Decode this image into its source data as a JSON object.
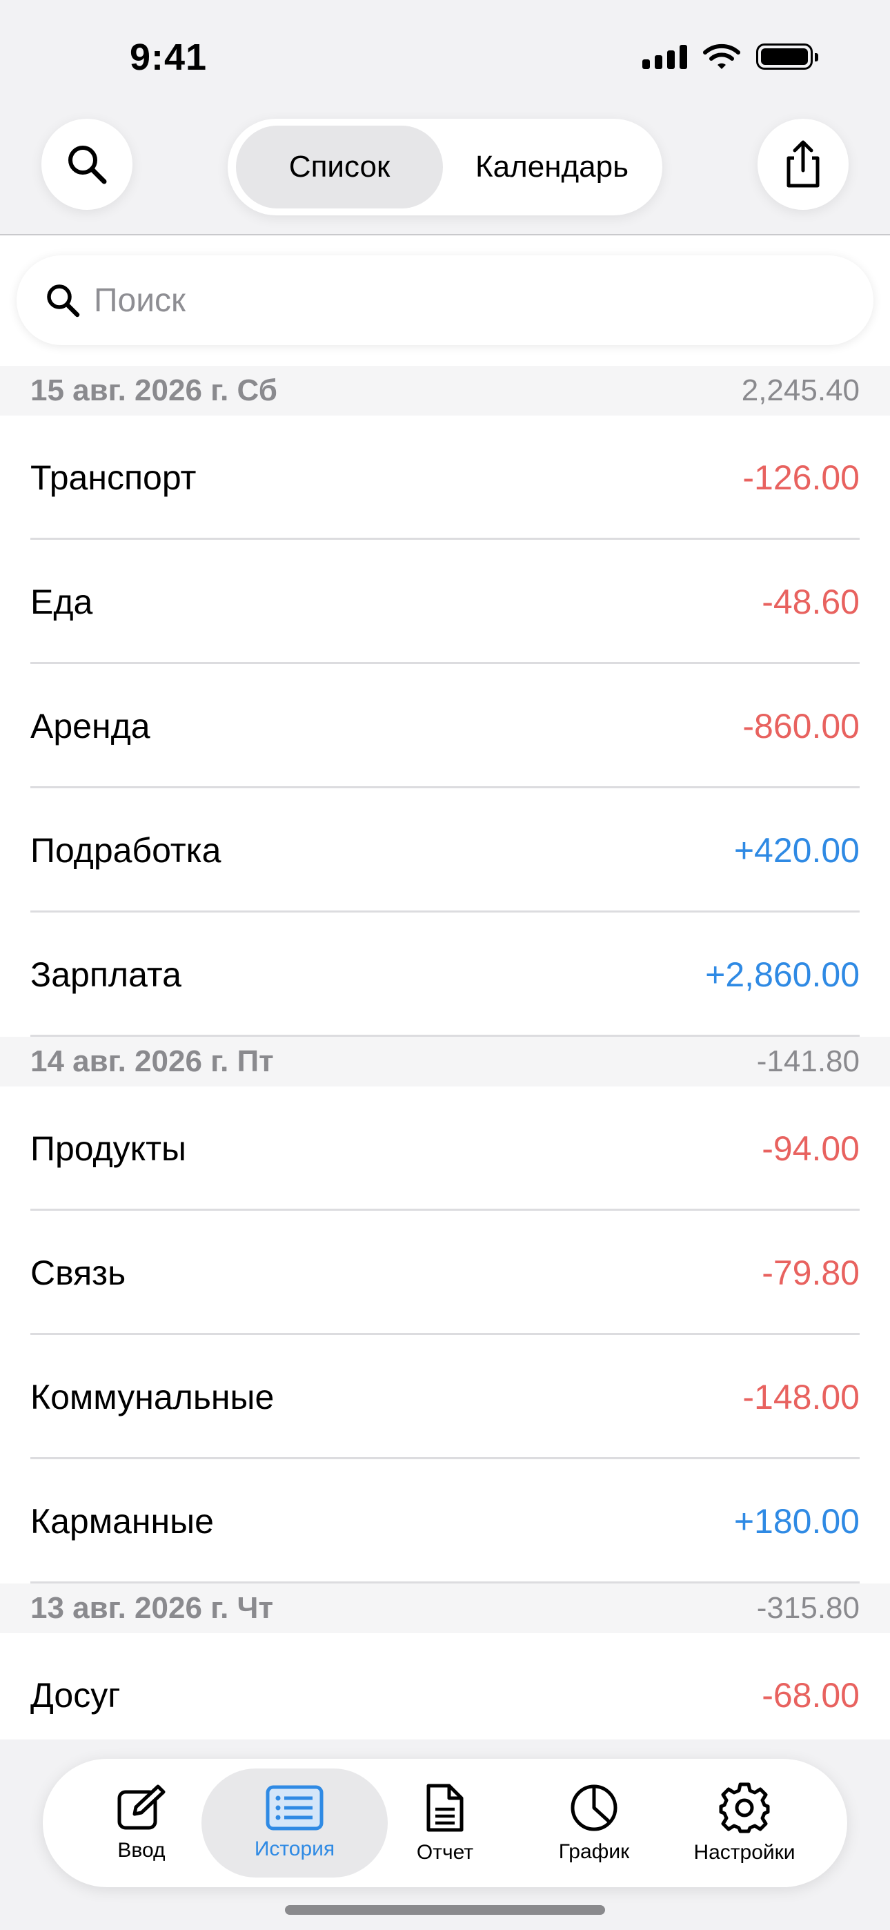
{
  "status_bar": {
    "time": "9:41"
  },
  "header": {
    "segments": [
      {
        "label": "Список",
        "active": true
      },
      {
        "label": "Календарь",
        "active": false
      }
    ]
  },
  "search": {
    "placeholder": "Поиск"
  },
  "colors": {
    "negative": "#e8625f",
    "positive": "#2f8ae4",
    "accent": "#2f8ae4"
  },
  "sections": [
    {
      "date": "15 авг. 2026 г. Сб",
      "total": "2,245.40",
      "rows": [
        {
          "label": "Транспорт",
          "amount": "-126.00",
          "sign": "neg"
        },
        {
          "label": "Еда",
          "amount": "-48.60",
          "sign": "neg"
        },
        {
          "label": "Аренда",
          "amount": "-860.00",
          "sign": "neg"
        },
        {
          "label": "Подработка",
          "amount": "+420.00",
          "sign": "pos"
        },
        {
          "label": "Зарплата",
          "amount": "+2,860.00",
          "sign": "pos"
        }
      ]
    },
    {
      "date": "14 авг. 2026 г. Пт",
      "total": "-141.80",
      "rows": [
        {
          "label": "Продукты",
          "amount": "-94.00",
          "sign": "neg"
        },
        {
          "label": "Связь",
          "amount": "-79.80",
          "sign": "neg"
        },
        {
          "label": "Коммунальные",
          "amount": "-148.00",
          "sign": "neg"
        },
        {
          "label": "Карманные",
          "amount": "+180.00",
          "sign": "pos"
        }
      ]
    },
    {
      "date": "13 авг. 2026 г. Чт",
      "total": "-315.80",
      "rows": [
        {
          "label": "Досуг",
          "amount": "-68.00",
          "sign": "neg"
        }
      ]
    }
  ],
  "tabbar": {
    "tabs": [
      {
        "label": "Ввод",
        "icon": "compose-icon",
        "active": false
      },
      {
        "label": "История",
        "icon": "list-icon",
        "active": true
      },
      {
        "label": "Отчет",
        "icon": "document-icon",
        "active": false
      },
      {
        "label": "График",
        "icon": "pie-chart-icon",
        "active": false
      },
      {
        "label": "Настройки",
        "icon": "gear-icon",
        "active": false
      }
    ]
  }
}
